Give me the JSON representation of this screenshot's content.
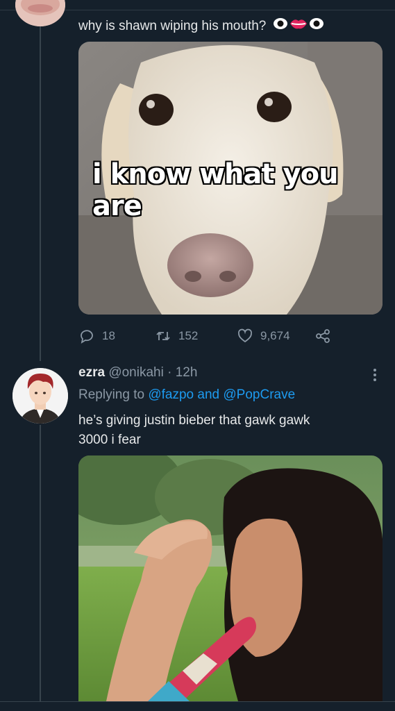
{
  "tweet1": {
    "text": "why is shawn wiping his mouth?",
    "emojis": [
      "eyes-emoji",
      "lips-emoji",
      "eyes-emoji"
    ],
    "image_caption": "i know what you are",
    "stats": {
      "replies": "18",
      "retweets": "152",
      "likes": "9,674"
    }
  },
  "tweet2": {
    "name": "ezra",
    "handle": "@onikahi",
    "separator": "·",
    "time": "12h",
    "replying_prefix": "Replying to",
    "replying_user1": "@fazpo",
    "replying_and": "and",
    "replying_user2": "@PopCrave",
    "text_line1": "he’s giving justin bieber that gawk gawk",
    "text_line2": "3000 i fear"
  },
  "colors": {
    "background": "#15202b",
    "accent": "#1d9bf0",
    "muted": "#8b98a5",
    "text": "#e7e9ea"
  },
  "icons": [
    "reply-icon",
    "retweet-icon",
    "like-icon",
    "share-icon",
    "more-icon"
  ]
}
